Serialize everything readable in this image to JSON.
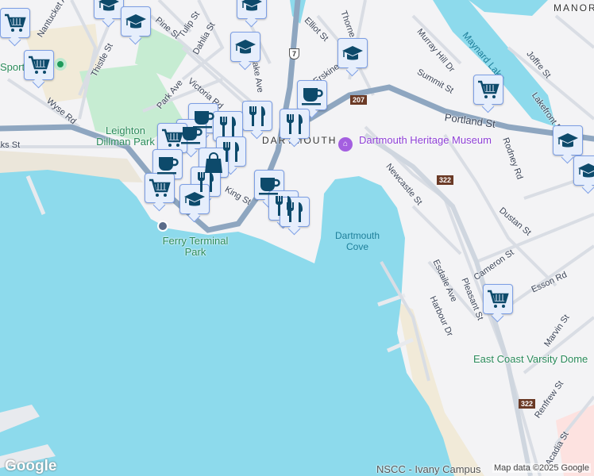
{
  "map": {
    "streets": [
      "Nantucket Ave",
      "Thistle St",
      "Wyse Rd",
      "Pine St",
      "Tulip St",
      "Dahlia St",
      "Victoria Rd",
      "Park Ave",
      "King St",
      "Elliot St",
      "Erskine St",
      "Thorne St",
      "Murray Hill Dr",
      "Summit St",
      "Portland St",
      "Joffre St",
      "Lakefront Rd",
      "Rodney Rd",
      "Newcastle St",
      "Dustan St",
      "Cameron St",
      "Esson Rd",
      "Esdaile Ave",
      "Harbour Dr",
      "Pleasant St",
      "Marvin St",
      "Renfrew St",
      "Acadia St",
      "Oaks St",
      "Albro Lake Ave"
    ],
    "parks": [
      "Leighton Dillman Park",
      "Ferry Terminal Park",
      "East Coast Varsity Dome",
      "Sport"
    ],
    "water": [
      "Dartmouth Cove",
      "Maynard Lake"
    ],
    "areas": [
      "MANOR",
      "DARTMOUTH"
    ],
    "poi": {
      "museum": "Dartmouth Heritage Museum",
      "campus": "NSCC - Ivany Campus"
    },
    "route_shields": [
      "207",
      "322",
      "322",
      "7"
    ],
    "logo": "Google",
    "copyright": "Map data ©2025 Google"
  },
  "marker_icons": [
    "shopping-cart-icon",
    "graduation-cap-icon",
    "coffee-cup-icon",
    "restaurant-icon",
    "shopping-bag-icon"
  ],
  "colors": {
    "water": "#8ddaec",
    "land": "#f3f3f5",
    "park": "#c6ecd2",
    "highway": "#8ea6c0",
    "marker_bg": "#e6eefc",
    "marker_border": "#7c9ee4",
    "icon": "#0d4a6b"
  }
}
